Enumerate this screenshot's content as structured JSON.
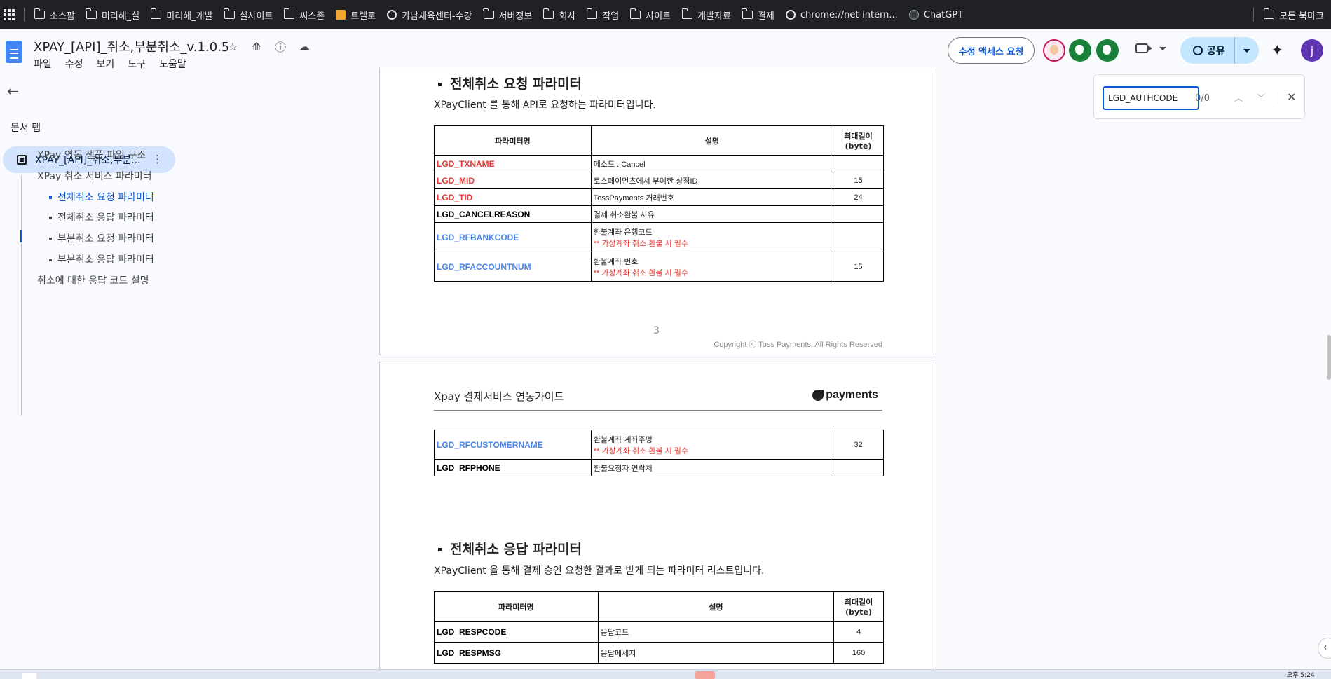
{
  "bookmarks": {
    "items": [
      {
        "label": "소스팜",
        "icon": "folder-icon"
      },
      {
        "label": "미리해_실",
        "icon": "folder-icon"
      },
      {
        "label": "미리해_개발",
        "icon": "folder-icon"
      },
      {
        "label": "실사이트",
        "icon": "folder-icon"
      },
      {
        "label": "씨스존",
        "icon": "folder-icon"
      },
      {
        "label": "트렐로",
        "icon": "trello-icon"
      },
      {
        "label": "가남체육센터-수강",
        "icon": "globe-icon"
      },
      {
        "label": "서버정보",
        "icon": "folder-icon"
      },
      {
        "label": "회사",
        "icon": "folder-icon"
      },
      {
        "label": "작업",
        "icon": "folder-icon"
      },
      {
        "label": "사이트",
        "icon": "folder-icon"
      },
      {
        "label": "개발자료",
        "icon": "folder-icon"
      },
      {
        "label": "결제",
        "icon": "folder-icon"
      },
      {
        "label": "chrome://net-intern...",
        "icon": "globe-icon"
      },
      {
        "label": "ChatGPT",
        "icon": "chatgpt-icon"
      }
    ],
    "all_bookmarks": "모든 북마크"
  },
  "header": {
    "title": "XPAY_[API]_취소,부분취소_v.1.0.5",
    "menu": [
      "파일",
      "수정",
      "보기",
      "도구",
      "도움말"
    ],
    "request_edit_label": "수정 액세스 요청",
    "share_label": "공유",
    "user_initial": "j"
  },
  "sidebar": {
    "tabs_label": "문서 탭",
    "active_tab": "XPAY_[API]_취소,부분...",
    "outline": [
      {
        "label": "XPay 연동 샘플 파일 구조",
        "level": 1,
        "active": false
      },
      {
        "label": "XPay 취소 서비스 파라미터",
        "level": 1,
        "active": false
      },
      {
        "label": "전체취소 요청 파라미터",
        "level": 2,
        "active": true
      },
      {
        "label": "전체취소 응답 파라미터",
        "level": 2,
        "active": false
      },
      {
        "label": "부분취소 요청 파라미터",
        "level": 2,
        "active": false
      },
      {
        "label": "부분취소 응답 파라미터",
        "level": 2,
        "active": false
      },
      {
        "label": "취소에 대한 응답 코드 설명",
        "level": 1,
        "active": false
      }
    ]
  },
  "page1": {
    "heading": "전체취소 요청 파라미터",
    "intro": "XPayClient 를 통해 API로 요청하는 파라미터입니다.",
    "table_headers": [
      "파라미터명",
      "설명",
      "최대길이 (byte)"
    ],
    "rows": [
      {
        "name": "LGD_TXNAME",
        "color": "red",
        "desc": "메소드 : Cancel",
        "note": "",
        "len": ""
      },
      {
        "name": "LGD_MID",
        "color": "red",
        "desc": "토스페이먼츠에서 부여한 상점ID",
        "note": "",
        "len": "15"
      },
      {
        "name": "LGD_TID",
        "color": "red",
        "desc": "TossPayments 거래번호",
        "note": "",
        "len": "24"
      },
      {
        "name": "LGD_CANCELREASON",
        "color": "black",
        "desc": "결제 취소환불 사유",
        "note": "",
        "len": ""
      },
      {
        "name": "LGD_RFBANKCODE",
        "color": "blue",
        "desc": "환불계좌 은행코드",
        "note": "** 가상계좌 취소 환불 시 필수",
        "len": ""
      },
      {
        "name": "LGD_RFACCOUNTNUM",
        "color": "blue",
        "desc": "환불계좌 번호",
        "note": "** 가상계좌 취소 환불 시 필수",
        "len": "15"
      }
    ],
    "page_number": "3",
    "copyright": "Copyright ⓒ Toss Payments. All Rights Reserved"
  },
  "page2": {
    "header_title": "Xpay 결제서비스 연동가이드",
    "logo_text": "payments",
    "rows_top": [
      {
        "name": "LGD_RFCUSTOMERNAME",
        "color": "blue",
        "desc": "환불계좌 계좌주명",
        "note": "** 가상계좌 취소 환불 시 필수",
        "len": "32"
      },
      {
        "name": "LGD_RFPHONE",
        "color": "black",
        "desc": "환불요청자 연락처",
        "note": "",
        "len": ""
      }
    ],
    "heading": "전체취소 응답 파라미터",
    "intro": "XPayClient 을 통해 결제 승인 요청한 결과로 받게 되는 파라미터 리스트입니다.",
    "table_headers": [
      "파라미터명",
      "설명",
      "최대길이 (byte)"
    ],
    "rows_resp": [
      {
        "name": "LGD_RESPCODE",
        "color": "black",
        "desc": "응답코드",
        "note": "",
        "len": "4"
      },
      {
        "name": "LGD_RESPMSG",
        "color": "black",
        "desc": "응답메세지",
        "note": "",
        "len": "160"
      }
    ]
  },
  "findbar": {
    "query": "LGD_AUTHCODE",
    "count": "0/0"
  },
  "taskbar": {
    "time": "오후 5:24"
  }
}
